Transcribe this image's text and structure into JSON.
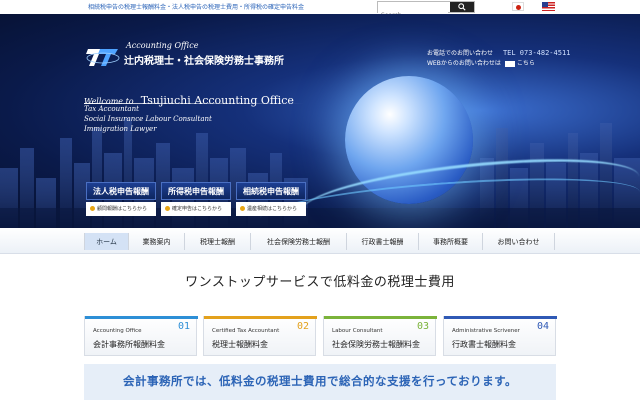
{
  "topbar": {
    "crumbs": "相続税申告の税理士報酬料金・法人税申告の税理士費用・所得税の確定申告料金",
    "search_placeholder": "Search …"
  },
  "header": {
    "logo_sub": "Accounting Office",
    "logo_name": "辻内税理士・社会保険労務士事務所",
    "phone_label": "お電話でのお問い合わせ",
    "phone": "TEL 073-482-4511",
    "web_label": "WEBからのお問い合わせは",
    "web_link": "こちら"
  },
  "hero": {
    "welcome": "Wellcome to",
    "office": "Tsujiuchi Accounting Office",
    "roles": [
      "Tax Accountant",
      "Social Insurance Labour Consultant",
      "Immigration Lawyer"
    ],
    "cards": [
      {
        "title": "法人税申告報酬",
        "sub": "顧問報酬はこちらから"
      },
      {
        "title": "所得税申告報酬",
        "sub": "確定申告はこちらから"
      },
      {
        "title": "相続税申告報酬",
        "sub": "遺産相続はこちらから"
      }
    ]
  },
  "nav": {
    "items": [
      "ホーム",
      "業務案内",
      "税理士報酬",
      "社会保険労務士報酬",
      "行政書士報酬",
      "事務所概要",
      "お問い合わせ"
    ]
  },
  "main": {
    "headline": "ワンストップサービスで低料金の税理士費用",
    "services": [
      {
        "en": "Accounting Office",
        "num": "01",
        "jp": "会計事務所報酬料金",
        "color": "#2d8fd6"
      },
      {
        "en": "Certified Tax Accountant",
        "num": "02",
        "jp": "税理士報酬料金",
        "color": "#e3a11c"
      },
      {
        "en": "Labour Consultant",
        "num": "03",
        "jp": "社会保険労務士報酬料金",
        "color": "#7bb33a"
      },
      {
        "en": "Administrative Scrivener",
        "num": "04",
        "jp": "行政書士報酬料金",
        "color": "#2f59b5"
      }
    ],
    "banner": "会計事務所では、低料金の税理士費用で総合的な支援を行っております。"
  }
}
